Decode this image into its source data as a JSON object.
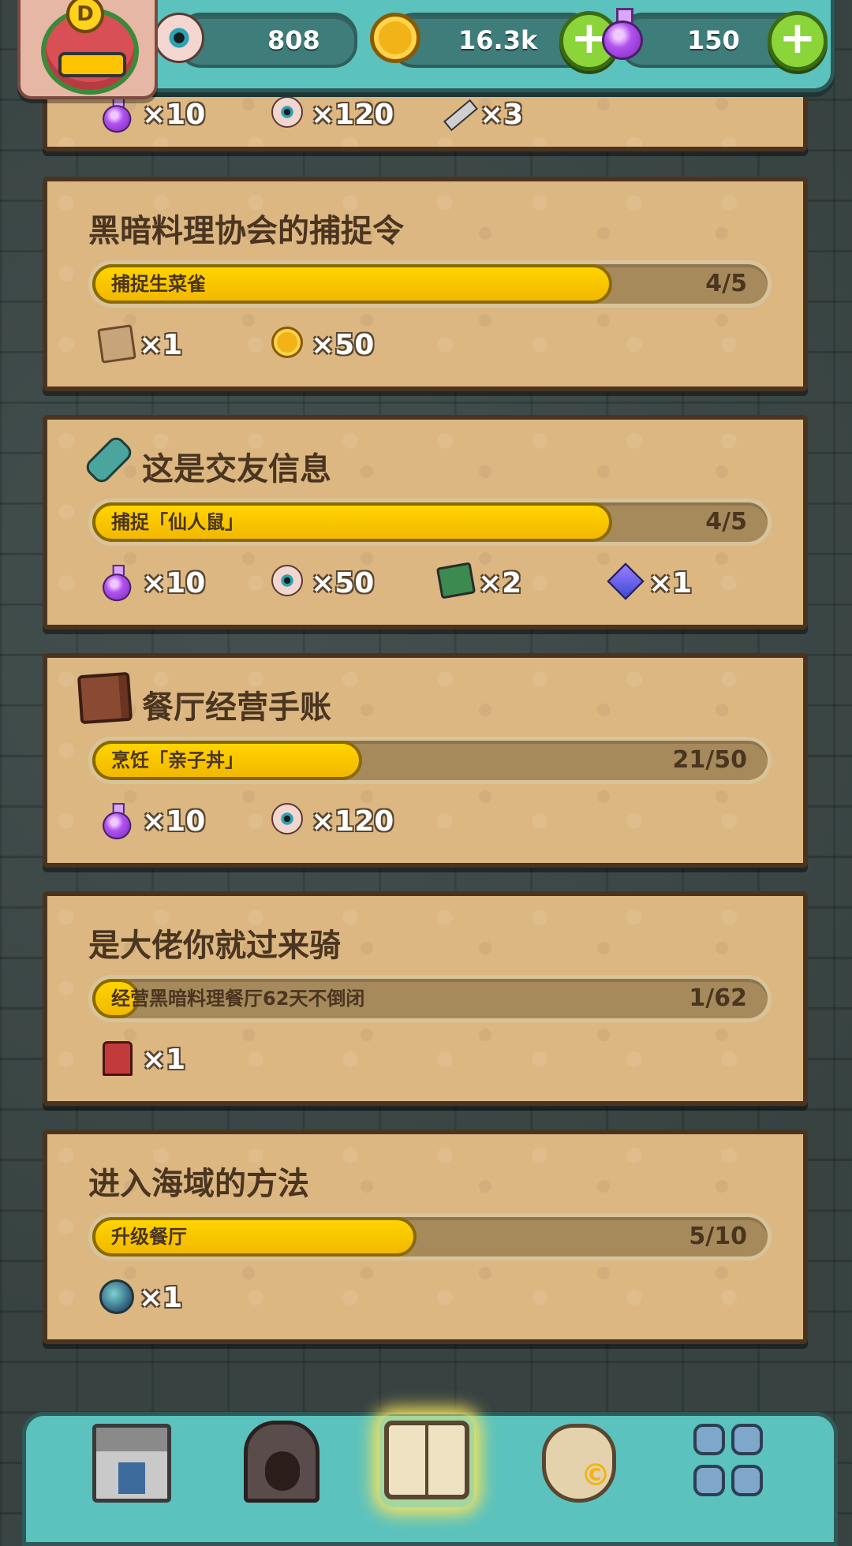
{
  "header": {
    "level_badge": "D",
    "eyeballs": "808",
    "coins": "16.3k",
    "potions": "150",
    "plus_symbol": "+"
  },
  "partial_top_rewards": [
    {
      "icon": "potion-icon",
      "count": "×10"
    },
    {
      "icon": "eyeball-icon",
      "count": "×120"
    },
    {
      "icon": "knife-icon",
      "count": "×3"
    }
  ],
  "quests": [
    {
      "title": "黑暗料理协会的捕捉令",
      "task": "捕捉生菜雀",
      "progress": "4/5",
      "progress_fraction": 0.8,
      "rewards": [
        {
          "icon": "scroll-icon",
          "count": "×1"
        },
        {
          "icon": "coin-icon",
          "count": "×50"
        }
      ]
    },
    {
      "title": "这是交友信息",
      "title_icon": "message-bottle-icon",
      "task": "捕捉「仙人鼠」",
      "progress": "4/5",
      "progress_fraction": 0.8,
      "rewards": [
        {
          "icon": "potion-icon",
          "count": "×10"
        },
        {
          "icon": "eyeball-icon",
          "count": "×50"
        },
        {
          "icon": "map-icon",
          "count": "×2"
        },
        {
          "icon": "crystal-icon",
          "count": "×1"
        }
      ]
    },
    {
      "title": "餐厅经营手账",
      "title_icon": "journal-book-icon",
      "task": "烹饪「亲子丼」",
      "progress": "21/50",
      "progress_fraction": 0.42,
      "rewards": [
        {
          "icon": "potion-icon",
          "count": "×10"
        },
        {
          "icon": "eyeball-icon",
          "count": "×120"
        }
      ]
    },
    {
      "title": "是大佬你就过来骑",
      "task": "经营黑暗料理餐厅62天不倒闭",
      "progress": "1/62",
      "progress_fraction": 0.016,
      "rewards": [
        {
          "icon": "throne-icon",
          "count": "×1"
        }
      ]
    },
    {
      "title": "进入海域的方法",
      "task": "升级餐厅",
      "progress": "5/10",
      "progress_fraction": 0.5,
      "rewards": [
        {
          "icon": "sea-orb-icon",
          "count": "×1"
        }
      ]
    }
  ],
  "bottom_nav": [
    {
      "name": "restaurant",
      "icon": "restaurant-building-icon",
      "active": false
    },
    {
      "name": "dungeon",
      "icon": "cave-monster-icon",
      "active": false
    },
    {
      "name": "quests",
      "icon": "open-book-icon",
      "active": true
    },
    {
      "name": "bag",
      "icon": "money-bag-icon",
      "active": false
    },
    {
      "name": "more",
      "icon": "grid-menu-icon",
      "active": false
    }
  ],
  "colors": {
    "progress_fill": "#ffd400",
    "card_bg": "#dcb782",
    "bar_accent": "#5cc2bd",
    "plus_button": "#8bd43a"
  }
}
